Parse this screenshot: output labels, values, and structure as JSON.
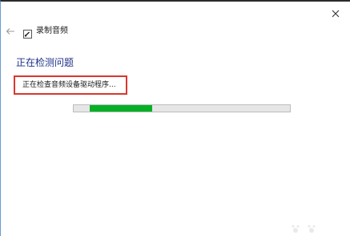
{
  "app": {
    "title": "录制音频",
    "close_icon": "close-icon",
    "back_icon": "back-arrow-icon",
    "app_icon": "audio-troubleshooter-icon"
  },
  "page": {
    "heading": "正在检测问题",
    "status_text": "正在检查音频设备驱动程序..."
  },
  "progress": {
    "value_fraction": 0.29,
    "fill_color": "#06b025",
    "track_color": "#e6e6e6"
  },
  "colors": {
    "heading": "#1e3287",
    "highlight_box": "#d8372f"
  }
}
